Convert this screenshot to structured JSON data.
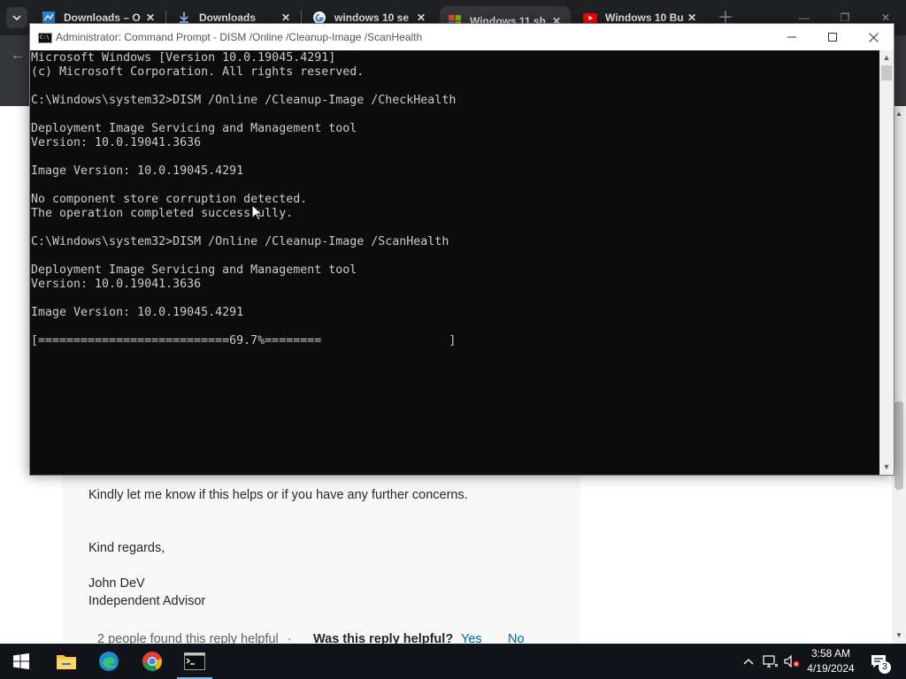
{
  "browser": {
    "tabs": [
      {
        "title": "Downloads – O",
        "icon": "app-icon"
      },
      {
        "title": "Downloads",
        "icon": "download-icon"
      },
      {
        "title": "windows 10 se",
        "icon": "google-icon"
      },
      {
        "title": "Windows 11 sh",
        "icon": "microsoft-icon",
        "active": true
      },
      {
        "title": "Windows 10 Bu",
        "icon": "youtube-icon"
      }
    ]
  },
  "page": {
    "reply_text": "Kindly let me know if this helps or if you have any further concerns.",
    "closing": "Kind regards,",
    "author_name": "John DeV",
    "author_role": "Independent Advisor",
    "helpful_count": "2 people found this reply helpful",
    "helpful_sep": "·",
    "helpful_question": "Was this reply helpful?",
    "yes_label": "Yes",
    "no_label": "No"
  },
  "cmd_window": {
    "title": "Administrator: Command Prompt - DISM  /Online /Cleanup-Image /ScanHealth",
    "console_lines": [
      "Microsoft Windows [Version 10.0.19045.4291]",
      "(c) Microsoft Corporation. All rights reserved.",
      "",
      "C:\\Windows\\system32>DISM /Online /Cleanup-Image /CheckHealth",
      "",
      "Deployment Image Servicing and Management tool",
      "Version: 10.0.19041.3636",
      "",
      "Image Version: 10.0.19045.4291",
      "",
      "No component store corruption detected.",
      "The operation completed successfully.",
      "",
      "C:\\Windows\\system32>DISM /Online /Cleanup-Image /ScanHealth",
      "",
      "Deployment Image Servicing and Management tool",
      "Version: 10.0.19041.3636",
      "",
      "Image Version: 10.0.19045.4291",
      "",
      "[===========================69.7%========                  ]"
    ],
    "progress_percent": 69.7
  },
  "taskbar": {
    "apps": [
      {
        "name": "file-explorer-icon"
      },
      {
        "name": "edge-icon"
      },
      {
        "name": "chrome-icon"
      },
      {
        "name": "command-prompt-icon",
        "active": true
      }
    ],
    "time": "3:58 AM",
    "date": "4/19/2024",
    "notification_count": "3"
  },
  "colors": {
    "console_bg": "#0c0c0c",
    "console_fg": "#cccccc",
    "taskbar_bg": "#101418",
    "link": "#0067b8"
  }
}
